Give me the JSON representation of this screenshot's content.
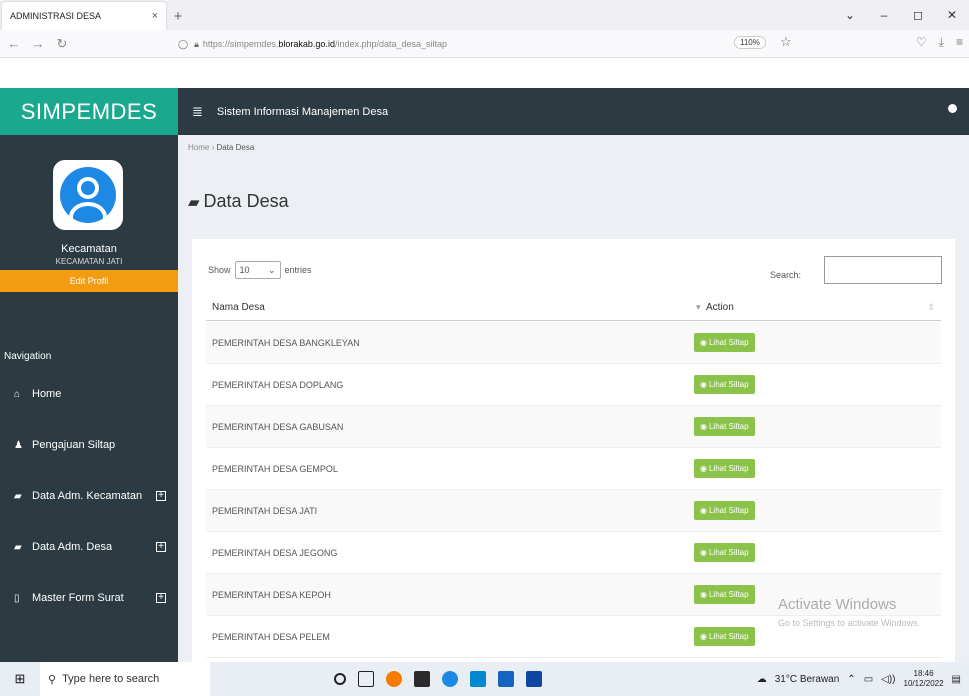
{
  "browser": {
    "tab_title": "ADMINISTRASI DESA",
    "tab_close": "×",
    "new_tab": "+",
    "url_prefix": "https://simpemdes.",
    "url_domain": "blorakab.go.id",
    "url_path": "/index.php/data_desa_siltap",
    "zoom": "110%"
  },
  "app": {
    "brand": "SIMPEMDES",
    "header_title": "Sistem Informasi Manajemen Desa"
  },
  "user": {
    "name": "Kecamatan",
    "subtitle": "KECAMATAN JATI",
    "edit_label": "Edit Profil"
  },
  "sidebar": {
    "nav_title": "Navigation",
    "items": [
      {
        "label": "Home",
        "icon": "home-icon"
      },
      {
        "label": "Pengajuan Siltap",
        "icon": "user-icon"
      },
      {
        "label": "Data Adm. Kecamatan",
        "icon": "book-icon"
      },
      {
        "label": "Data Adm. Desa",
        "icon": "book-icon"
      },
      {
        "label": "Master Form Surat",
        "icon": "file-icon"
      }
    ]
  },
  "breadcrumb": {
    "home": "Home",
    "current": "Data Desa"
  },
  "page": {
    "title": "Data Desa"
  },
  "table": {
    "show_label": "Show",
    "entries_value": "10",
    "entries_label": "entries",
    "search_label": "Search:",
    "col_name": "Nama Desa",
    "col_action": "Action",
    "button_label": "Lihat Siltap",
    "rows": [
      "PEMERINTAH DESA BANGKLEYAN",
      "PEMERINTAH DESA DOPLANG",
      "PEMERINTAH DESA GABUSAN",
      "PEMERINTAH DESA GEMPOL",
      "PEMERINTAH DESA JATI",
      "PEMERINTAH DESA JEGONG",
      "PEMERINTAH DESA KEPOH",
      "PEMERINTAH DESA PELEM"
    ]
  },
  "watermark": {
    "title": "Activate Windows",
    "subtitle": "Go to Settings to activate Windows."
  },
  "taskbar": {
    "search_placeholder": "Type here to search",
    "weather": "31°C  Berawan",
    "time": "18:46",
    "date": "10/12/2022"
  }
}
